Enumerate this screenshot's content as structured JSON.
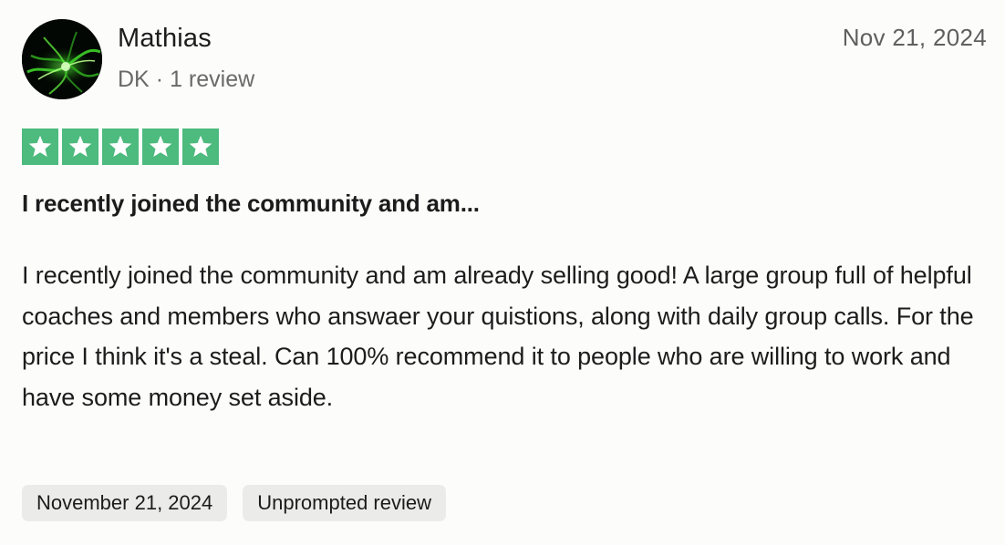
{
  "reviewer": {
    "name": "Mathias",
    "country": "DK",
    "review_count": "1 review"
  },
  "review": {
    "date": "Nov 21, 2024",
    "rating": 5,
    "rating_max": 5,
    "title": "I recently joined the community and am...",
    "body": "I recently joined the community and am already selling good! A large group full of helpful coaches and members who answaer your quistions, along with daily group calls. For the price I think it's a steal. Can 100% recommend it to people who are willing to work and have some money set aside.",
    "tags": [
      "November 21, 2024",
      "Unprompted review"
    ]
  },
  "colors": {
    "star_fill": "#4dba7e",
    "avatar_bg": "#030703",
    "avatar_accent": "#3fd32a",
    "tag_bg": "#ebebea"
  },
  "icons": {
    "star": "star-icon",
    "avatar": "avatar-image"
  }
}
